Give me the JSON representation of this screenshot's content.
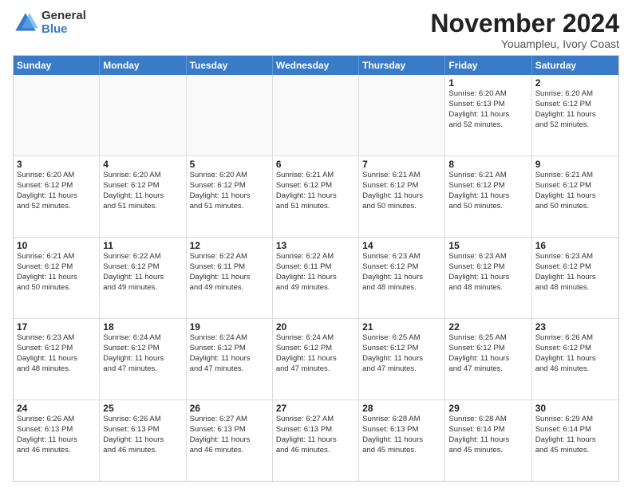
{
  "logo": {
    "general": "General",
    "blue": "Blue"
  },
  "title": {
    "month": "November 2024",
    "location": "Youampleu, Ivory Coast"
  },
  "calendar": {
    "headers": [
      "Sunday",
      "Monday",
      "Tuesday",
      "Wednesday",
      "Thursday",
      "Friday",
      "Saturday"
    ],
    "weeks": [
      [
        {
          "day": "",
          "info": ""
        },
        {
          "day": "",
          "info": ""
        },
        {
          "day": "",
          "info": ""
        },
        {
          "day": "",
          "info": ""
        },
        {
          "day": "",
          "info": ""
        },
        {
          "day": "1",
          "info": "Sunrise: 6:20 AM\nSunset: 6:13 PM\nDaylight: 11 hours\nand 52 minutes."
        },
        {
          "day": "2",
          "info": "Sunrise: 6:20 AM\nSunset: 6:12 PM\nDaylight: 11 hours\nand 52 minutes."
        }
      ],
      [
        {
          "day": "3",
          "info": "Sunrise: 6:20 AM\nSunset: 6:12 PM\nDaylight: 11 hours\nand 52 minutes."
        },
        {
          "day": "4",
          "info": "Sunrise: 6:20 AM\nSunset: 6:12 PM\nDaylight: 11 hours\nand 51 minutes."
        },
        {
          "day": "5",
          "info": "Sunrise: 6:20 AM\nSunset: 6:12 PM\nDaylight: 11 hours\nand 51 minutes."
        },
        {
          "day": "6",
          "info": "Sunrise: 6:21 AM\nSunset: 6:12 PM\nDaylight: 11 hours\nand 51 minutes."
        },
        {
          "day": "7",
          "info": "Sunrise: 6:21 AM\nSunset: 6:12 PM\nDaylight: 11 hours\nand 50 minutes."
        },
        {
          "day": "8",
          "info": "Sunrise: 6:21 AM\nSunset: 6:12 PM\nDaylight: 11 hours\nand 50 minutes."
        },
        {
          "day": "9",
          "info": "Sunrise: 6:21 AM\nSunset: 6:12 PM\nDaylight: 11 hours\nand 50 minutes."
        }
      ],
      [
        {
          "day": "10",
          "info": "Sunrise: 6:21 AM\nSunset: 6:12 PM\nDaylight: 11 hours\nand 50 minutes."
        },
        {
          "day": "11",
          "info": "Sunrise: 6:22 AM\nSunset: 6:12 PM\nDaylight: 11 hours\nand 49 minutes."
        },
        {
          "day": "12",
          "info": "Sunrise: 6:22 AM\nSunset: 6:11 PM\nDaylight: 11 hours\nand 49 minutes."
        },
        {
          "day": "13",
          "info": "Sunrise: 6:22 AM\nSunset: 6:11 PM\nDaylight: 11 hours\nand 49 minutes."
        },
        {
          "day": "14",
          "info": "Sunrise: 6:23 AM\nSunset: 6:12 PM\nDaylight: 11 hours\nand 48 minutes."
        },
        {
          "day": "15",
          "info": "Sunrise: 6:23 AM\nSunset: 6:12 PM\nDaylight: 11 hours\nand 48 minutes."
        },
        {
          "day": "16",
          "info": "Sunrise: 6:23 AM\nSunset: 6:12 PM\nDaylight: 11 hours\nand 48 minutes."
        }
      ],
      [
        {
          "day": "17",
          "info": "Sunrise: 6:23 AM\nSunset: 6:12 PM\nDaylight: 11 hours\nand 48 minutes."
        },
        {
          "day": "18",
          "info": "Sunrise: 6:24 AM\nSunset: 6:12 PM\nDaylight: 11 hours\nand 47 minutes."
        },
        {
          "day": "19",
          "info": "Sunrise: 6:24 AM\nSunset: 6:12 PM\nDaylight: 11 hours\nand 47 minutes."
        },
        {
          "day": "20",
          "info": "Sunrise: 6:24 AM\nSunset: 6:12 PM\nDaylight: 11 hours\nand 47 minutes."
        },
        {
          "day": "21",
          "info": "Sunrise: 6:25 AM\nSunset: 6:12 PM\nDaylight: 11 hours\nand 47 minutes."
        },
        {
          "day": "22",
          "info": "Sunrise: 6:25 AM\nSunset: 6:12 PM\nDaylight: 11 hours\nand 47 minutes."
        },
        {
          "day": "23",
          "info": "Sunrise: 6:26 AM\nSunset: 6:12 PM\nDaylight: 11 hours\nand 46 minutes."
        }
      ],
      [
        {
          "day": "24",
          "info": "Sunrise: 6:26 AM\nSunset: 6:13 PM\nDaylight: 11 hours\nand 46 minutes."
        },
        {
          "day": "25",
          "info": "Sunrise: 6:26 AM\nSunset: 6:13 PM\nDaylight: 11 hours\nand 46 minutes."
        },
        {
          "day": "26",
          "info": "Sunrise: 6:27 AM\nSunset: 6:13 PM\nDaylight: 11 hours\nand 46 minutes."
        },
        {
          "day": "27",
          "info": "Sunrise: 6:27 AM\nSunset: 6:13 PM\nDaylight: 11 hours\nand 46 minutes."
        },
        {
          "day": "28",
          "info": "Sunrise: 6:28 AM\nSunset: 6:13 PM\nDaylight: 11 hours\nand 45 minutes."
        },
        {
          "day": "29",
          "info": "Sunrise: 6:28 AM\nSunset: 6:14 PM\nDaylight: 11 hours\nand 45 minutes."
        },
        {
          "day": "30",
          "info": "Sunrise: 6:29 AM\nSunset: 6:14 PM\nDaylight: 11 hours\nand 45 minutes."
        }
      ]
    ]
  }
}
